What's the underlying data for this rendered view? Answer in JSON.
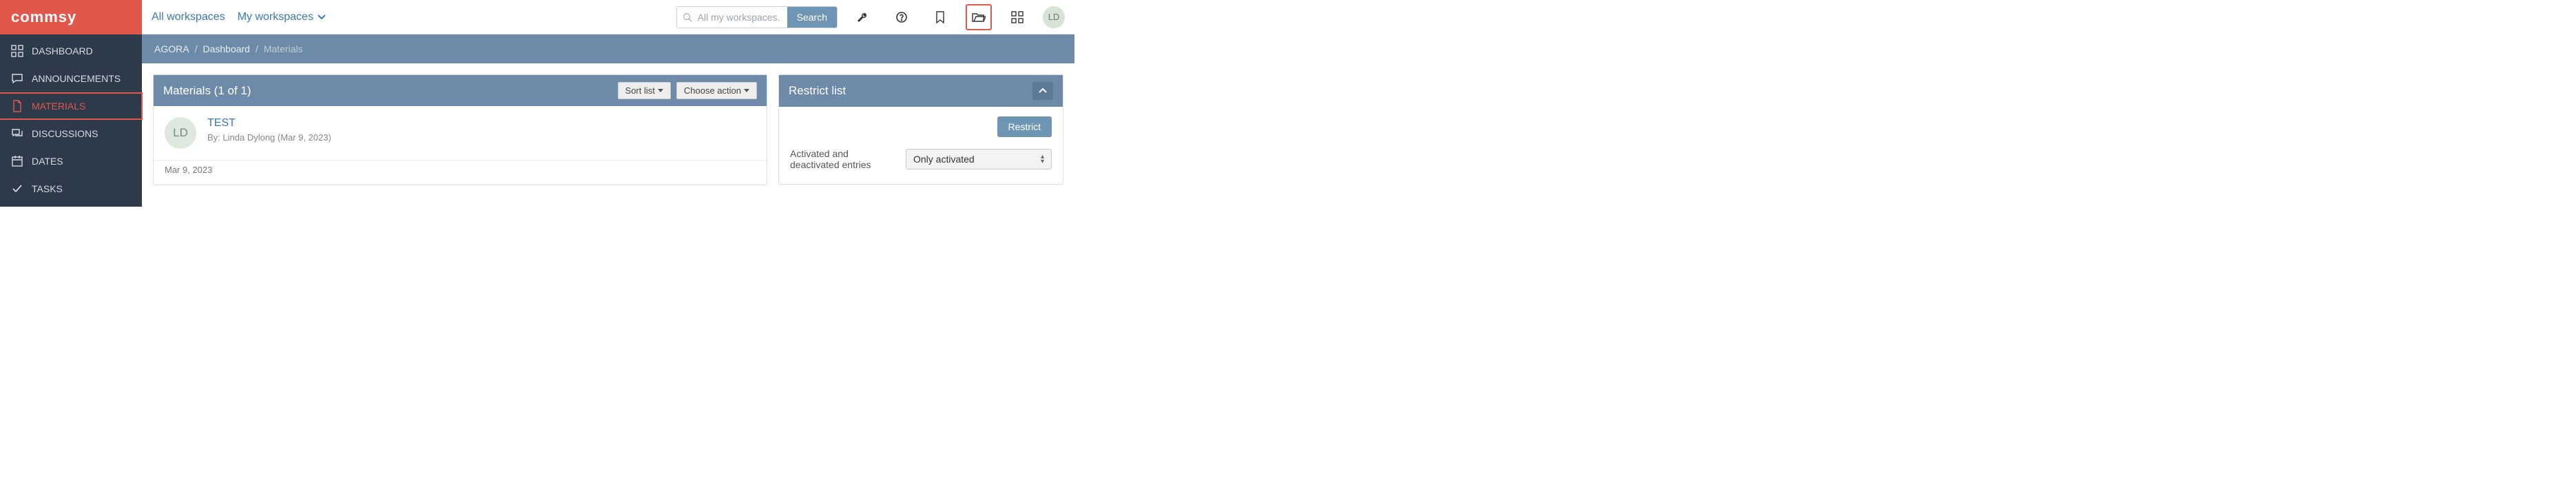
{
  "logo_text": "commsy",
  "sidebar": {
    "items": [
      {
        "label": "DASHBOARD",
        "icon": "dashboard"
      },
      {
        "label": "ANNOUNCEMENTS",
        "icon": "announcement"
      },
      {
        "label": "MATERIALS",
        "icon": "material",
        "active": true
      },
      {
        "label": "DISCUSSIONS",
        "icon": "discussion"
      },
      {
        "label": "DATES",
        "icon": "dates"
      },
      {
        "label": "TASKS",
        "icon": "tasks"
      }
    ]
  },
  "topbar": {
    "all_workspaces": "All workspaces",
    "my_workspaces": "My workspaces",
    "search_placeholder": "All my workspaces...",
    "search_button": "Search",
    "user_initials": "LD"
  },
  "breadcrumb": {
    "root": "AGORA",
    "middle": "Dashboard",
    "current": "Materials"
  },
  "materials_panel": {
    "title": "Materials (1 of 1)",
    "sort_label": "Sort list",
    "action_label": "Choose action",
    "item": {
      "avatar_initials": "LD",
      "title": "TEST",
      "byline": "By: Linda Dylong (Mar 9, 2023)",
      "date": "Mar 9, 2023"
    }
  },
  "restrict_panel": {
    "title": "Restrict list",
    "button": "Restrict",
    "filter_label": "Activated and deactivated entries",
    "filter_value": "Only activated"
  }
}
